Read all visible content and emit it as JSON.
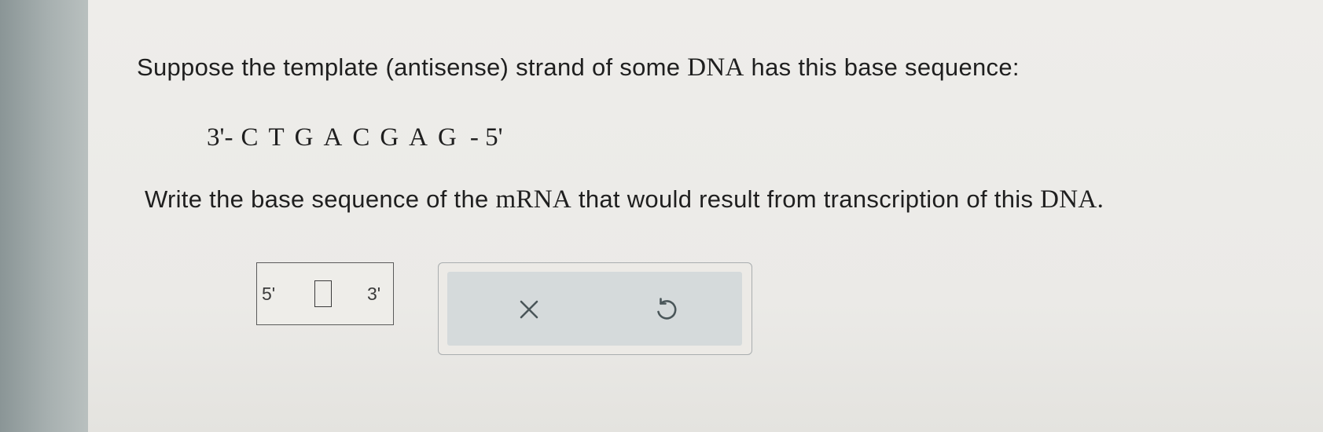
{
  "question": {
    "prompt_start": "Suppose the template (antisense) strand of some ",
    "prompt_term": "DNA",
    "prompt_end": " has this base sequence:",
    "template_strand": {
      "left_end": "3'-",
      "bases": [
        "C",
        "T",
        "G",
        "A",
        "C",
        "G",
        "A",
        "G"
      ],
      "right_end": "- 5'"
    },
    "instruction_start": "Write the base sequence of the ",
    "instruction_term1": "mRNA",
    "instruction_middle": " that would result from transcription of this ",
    "instruction_term2": "DNA",
    "instruction_end": "."
  },
  "answer": {
    "left_label": "5'",
    "right_label": "3'",
    "value": ""
  },
  "actions": {
    "clear_icon": "x-icon",
    "undo_icon": "undo-icon"
  },
  "colors": {
    "side_strip": "#a7b0b0",
    "background": "#ecebe8",
    "action_panel": "#d5dadb",
    "icon": "#4a5659"
  }
}
